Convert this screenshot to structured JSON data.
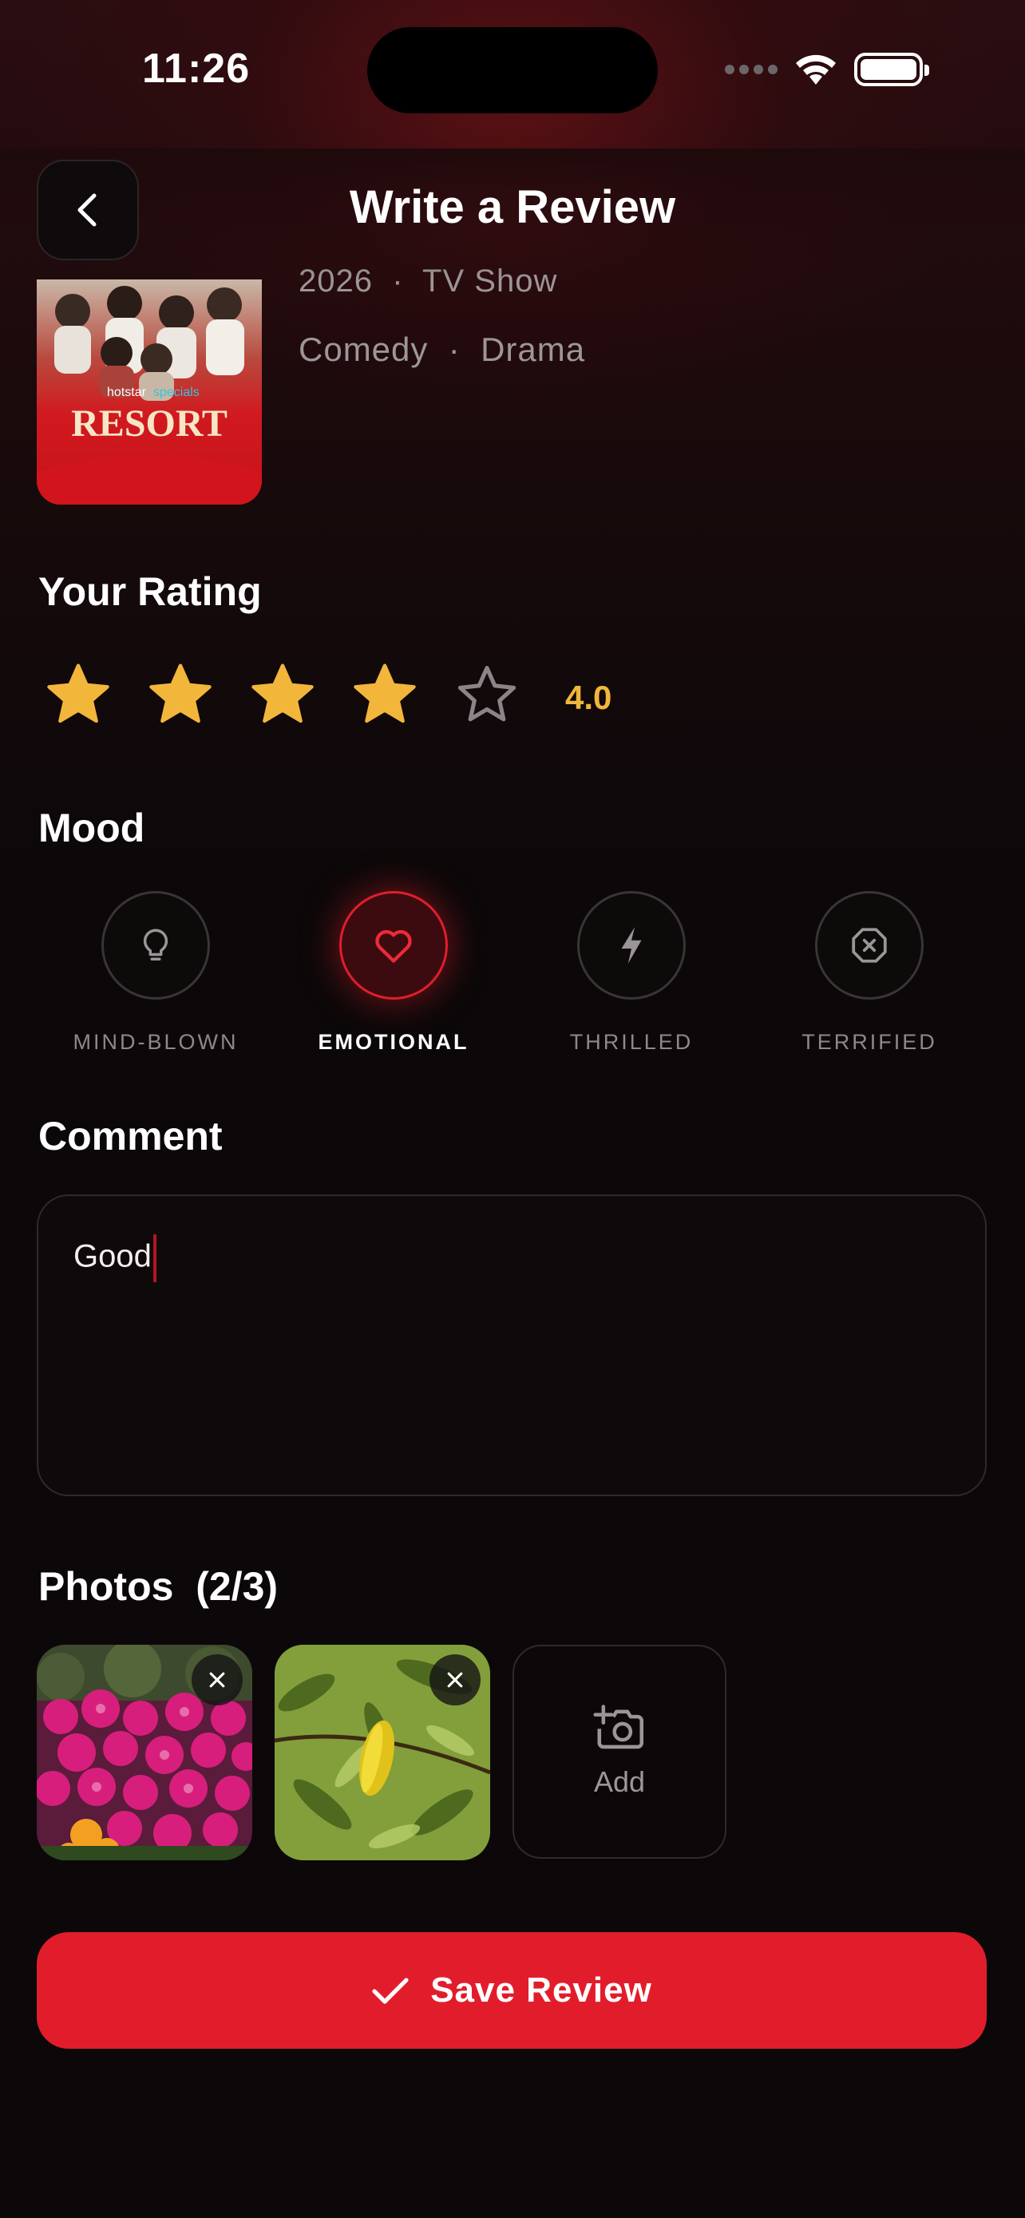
{
  "status_bar": {
    "time": "11:26"
  },
  "header": {
    "title": "Write a Review",
    "back_icon": "chevron-left-icon"
  },
  "movie": {
    "year": "2026",
    "type": "TV Show",
    "genres": [
      "Comedy",
      "Drama"
    ],
    "poster_title": "RESORT",
    "poster_badge": "hotstar specials"
  },
  "rating": {
    "title": "Your Rating",
    "value": "4.0",
    "stars_filled": 4,
    "stars_total": 5,
    "color": "#f2b63b"
  },
  "mood": {
    "title": "Mood",
    "options": [
      {
        "label": "MIND-BLOWN",
        "icon": "lightbulb-icon",
        "selected": false
      },
      {
        "label": "EMOTIONAL",
        "icon": "heart-icon",
        "selected": true
      },
      {
        "label": "THRILLED",
        "icon": "lightning-icon",
        "selected": false
      },
      {
        "label": "TERRIFIED",
        "icon": "x-circle-icon",
        "selected": false
      }
    ]
  },
  "comment": {
    "title": "Comment",
    "value": "Good"
  },
  "photos": {
    "title": "Photos",
    "count": "(2/3)",
    "add_label": "Add",
    "items": [
      "flowers-photo",
      "leaves-photo"
    ]
  },
  "save": {
    "label": "Save Review",
    "icon": "check-icon",
    "color": "#e21d2b"
  }
}
